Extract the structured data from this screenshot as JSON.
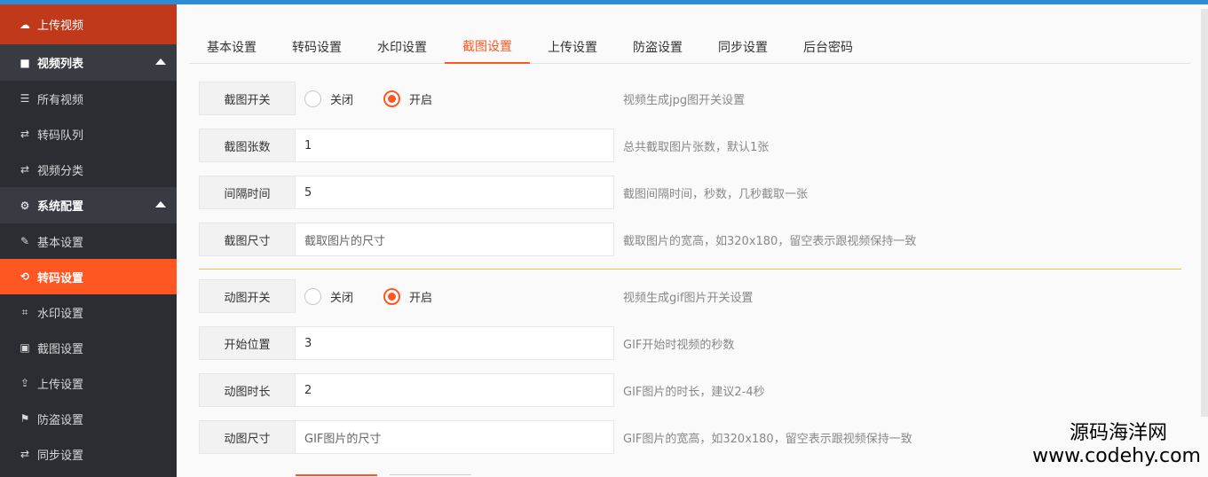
{
  "sidebar": {
    "upload": "上传视频",
    "groups": [
      {
        "label": "视频列表",
        "items": [
          "所有视频",
          "转码队列",
          "视频分类"
        ]
      },
      {
        "label": "系统配置",
        "items": [
          "基本设置",
          "转码设置",
          "水印设置",
          "截图设置",
          "上传设置",
          "防盗设置",
          "同步设置"
        ]
      }
    ]
  },
  "tabs": [
    "基本设置",
    "转码设置",
    "水印设置",
    "截图设置",
    "上传设置",
    "防盗设置",
    "同步设置",
    "后台密码"
  ],
  "active_tab": "截图设置",
  "radio": {
    "off": "关闭",
    "on": "开启"
  },
  "form": {
    "shot_switch": {
      "label": "截图开关",
      "tip": "视频生成jpg图开关设置"
    },
    "shot_count": {
      "label": "截图张数",
      "value": "1",
      "tip": "总共截取图片张数，默认1张"
    },
    "interval": {
      "label": "间隔时间",
      "value": "5",
      "tip": "截图间隔时间，秒数，几秒截取一张"
    },
    "shot_size": {
      "label": "截图尺寸",
      "placeholder": "截取图片的尺寸",
      "tip": "截取图片的宽高，如320x180，留空表示跟视频保持一致"
    },
    "gif_switch": {
      "label": "动图开关",
      "tip": "视频生成gif图片开关设置"
    },
    "start_pos": {
      "label": "开始位置",
      "value": "3",
      "tip": "GIF开始时视频的秒数"
    },
    "gif_duration": {
      "label": "动图时长",
      "value": "2",
      "tip": "GIF图片的时长，建议2-4秒"
    },
    "gif_size": {
      "label": "动图尺寸",
      "placeholder": "GIF图片的尺寸",
      "tip": "GIF图片的宽高，如320x180，留空表示跟视频保持一致"
    }
  },
  "watermark": {
    "line1": "源码海洋网",
    "line2": "www.codehy.com"
  },
  "colors": {
    "accent": "#ff5722",
    "sidebar": "#2b2d33",
    "upload": "#c1391b"
  }
}
